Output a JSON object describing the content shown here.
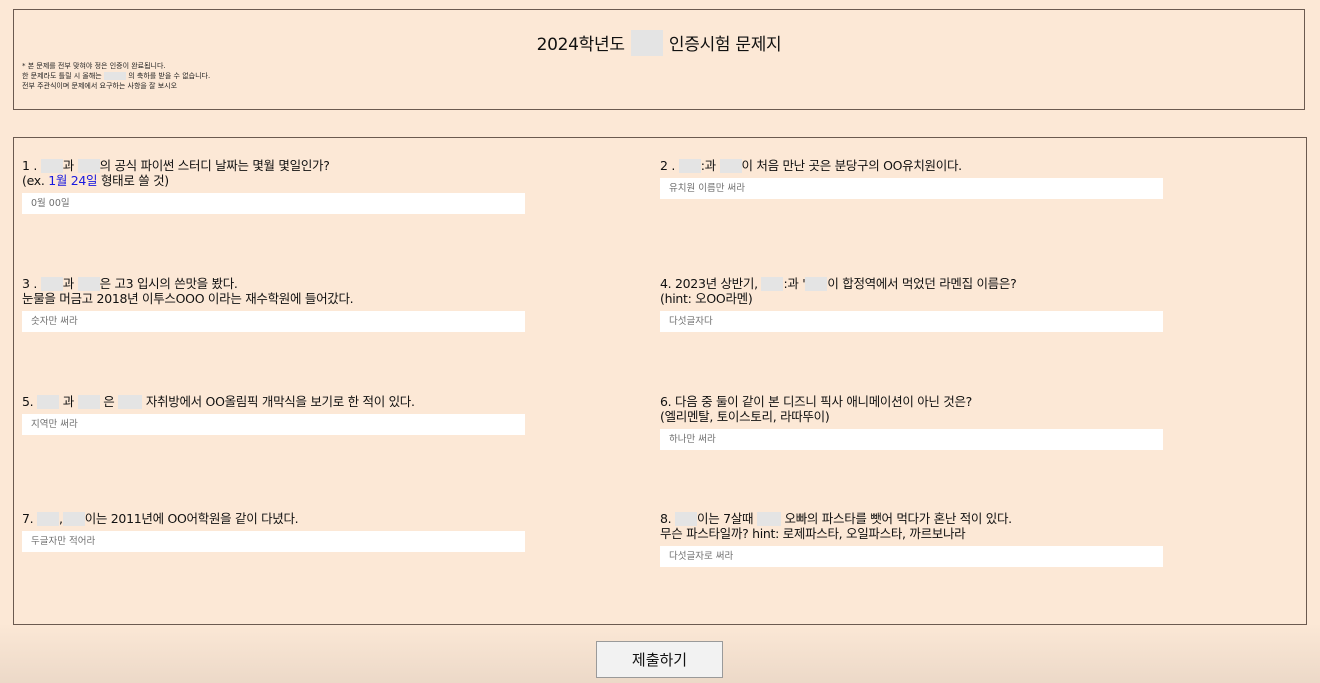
{
  "header": {
    "title_pre": "2024학년도",
    "title_post": "인증시험 문제지",
    "notes": {
      "line1": "* 본 문제를 전부 맞혀야 정은 인증이 완료됩니다.",
      "line2_pre": "한 문제라도 틀릴 시 올해는",
      "line2_post": "의 축하를 받을 수 없습니다.",
      "line3": "전부 주관식이며 문제에서 요구하는 사항을 잘 보시오"
    }
  },
  "questions": [
    {
      "a": "1 .",
      "b": "과",
      "c": "의 공식 파이썬 스터디 날짜는 몇월 몇일인가?",
      "line2_pre": "(ex.",
      "line2_blue": "1월 24일",
      "line2_post": "형태로 쓸 것)",
      "placeholder": "0월 00일"
    },
    {
      "a": "2 .",
      "b": ":과",
      "c": "이 처음 만난 곳은 분당구의 OO유치원이다.",
      "placeholder": "유치원 이름만 써라"
    },
    {
      "a": "3 .",
      "b": "과",
      "c": "은 고3 입시의 쓴맛을 봤다.",
      "line2": "눈물을 머금고 2018년 이투스OOO 이라는 재수학원에 들어갔다.",
      "placeholder": "숫자만 써라"
    },
    {
      "a": "4. 2023년 상반기,",
      "b": ":과 '",
      "c": "이 합정역에서 먹었던 라멘집 이름은?",
      "line2": "(hint: 오OO라멘)",
      "placeholder": "다섯글자다"
    },
    {
      "a": "5.",
      "b": "과",
      "c": "은",
      "d": "자취방에서 OO올림픽 개막식을 보기로 한 적이 있다.",
      "placeholder": "지역만 써라"
    },
    {
      "a": "6. 다음 중 둘이 같이 본 디즈니 픽사 애니메이션이 아닌 것은?",
      "line2": "(엘리멘탈, 토이스토리, 라따뚜이)",
      "placeholder": "하나만 써라"
    },
    {
      "a": "7.",
      "b": ",",
      "c": "이는 2011년에 OO어학원을 같이 다녔다.",
      "placeholder": "두글자만 적어라"
    },
    {
      "a": "8.",
      "b": "이는 7살때",
      "c": "오빠의 파스타를 뺏어 먹다가 혼난 적이 있다.",
      "line2": "무슨 파스타일까? hint: 로제파스타, 오일파스타, 까르보나라",
      "placeholder": "다섯글자로 써라"
    }
  ],
  "submit_label": "제출하기"
}
